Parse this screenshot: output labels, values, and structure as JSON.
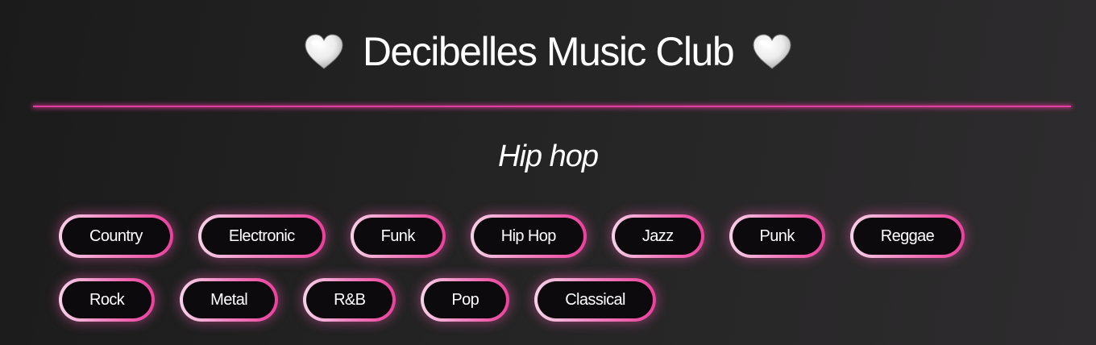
{
  "header": {
    "title": "Decibelles Music Club",
    "left_icon": "heart-icon",
    "right_icon": "heart-icon"
  },
  "selected_genre": "Hip hop",
  "genres": [
    {
      "label": "Country"
    },
    {
      "label": "Electronic"
    },
    {
      "label": "Funk"
    },
    {
      "label": "Hip Hop"
    },
    {
      "label": "Jazz"
    },
    {
      "label": "Punk"
    },
    {
      "label": "Reggae"
    },
    {
      "label": "Rock"
    },
    {
      "label": "Metal"
    },
    {
      "label": "R&B"
    },
    {
      "label": "Pop"
    },
    {
      "label": "Classical"
    }
  ],
  "colors": {
    "background": "#1b1b1b",
    "accent": "#ec3f9c",
    "button_fill": "#0c0a0d",
    "text": "#ffffff"
  }
}
